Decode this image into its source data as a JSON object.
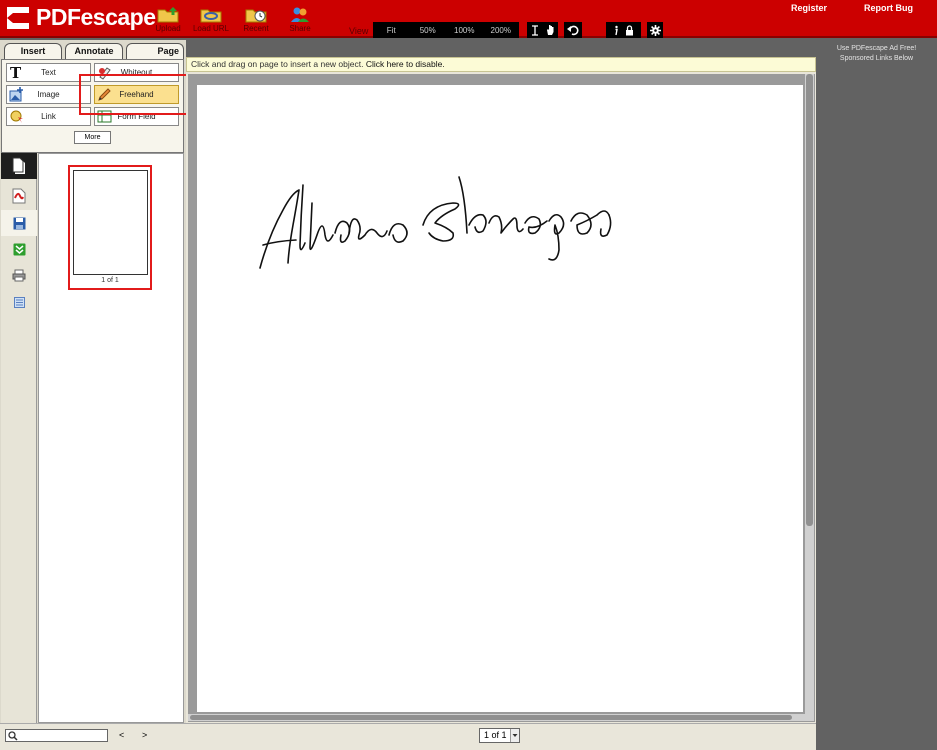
{
  "header": {
    "logo_text": "PDFescape",
    "toolbar": [
      {
        "label": "Upload",
        "icon": "folder-upload-icon"
      },
      {
        "label": "Load URL",
        "icon": "folder-link-icon"
      },
      {
        "label": "Recent",
        "icon": "folder-clock-icon"
      },
      {
        "label": "Share",
        "icon": "people-share-icon"
      }
    ],
    "view_label": "View",
    "zoom_options": [
      "Fit",
      "50%",
      "100%",
      "200%"
    ],
    "register_label": "Register",
    "report_bug_label": "Report Bug"
  },
  "tabs": [
    "Insert",
    "Annotate",
    "Page"
  ],
  "insert_tools": [
    {
      "label": "Text",
      "icon": "text-icon"
    },
    {
      "label": "Whiteout",
      "icon": "whiteout-icon"
    },
    {
      "label": "Image",
      "icon": "image-icon"
    },
    {
      "label": "Freehand",
      "icon": "pencil-icon",
      "active": true
    },
    {
      "label": "Link",
      "icon": "link-icon"
    },
    {
      "label": "Form Field",
      "icon": "form-field-icon"
    }
  ],
  "more_label": "More",
  "info_bar": {
    "message": "Click and drag on page to insert a new object. ",
    "link": "Click here to disable."
  },
  "sidebar_icons": [
    "pages-icon",
    "pdf-icon",
    "save-icon",
    "download-icon",
    "print-icon",
    "layout-icon"
  ],
  "thumbnail": {
    "label": "1 of 1"
  },
  "status_bar": {
    "prev_label": "<",
    "next_label": ">",
    "page_select_value": "1 of 1"
  },
  "ad_panel": {
    "line1": "Use PDFescape Ad Free!",
    "line2": "Sponsored Links Below"
  },
  "colors": {
    "header_red": "#cc0000",
    "highlight_red": "#e21b1b",
    "active_tool": "#fbe08f"
  }
}
